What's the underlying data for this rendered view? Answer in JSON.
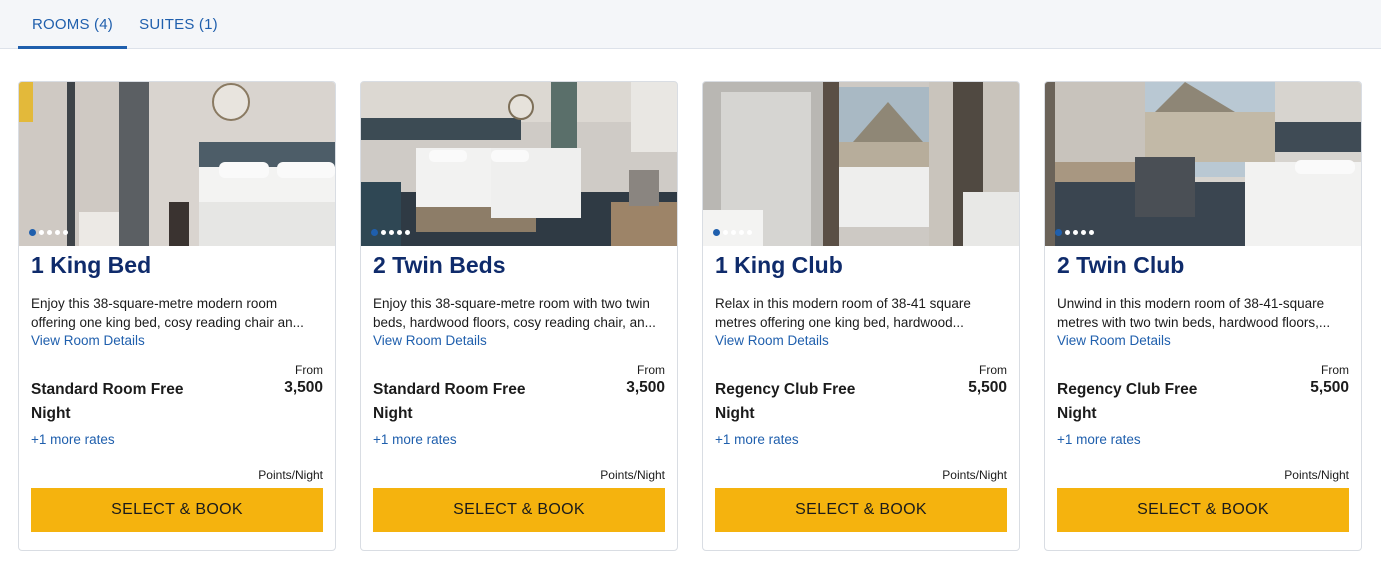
{
  "tabs": [
    {
      "label": "ROOMS (4)",
      "active": true
    },
    {
      "label": "SUITES (1)",
      "active": false
    }
  ],
  "colors": {
    "accent": "#1f5fad",
    "title": "#0f2b6b",
    "button": "#f5b30e"
  },
  "rooms": [
    {
      "title": "1 King Bed",
      "description": "Enjoy this 38-square-metre modern room offering one king bed, cosy reading chair an...",
      "details_link": "View Room Details",
      "from_label": "From",
      "rate_name": "Standard Room Free Night",
      "points": "3,500",
      "more_rates": "+1 more rates",
      "points_unit": "Points/Night",
      "button": "SELECT & BOOK"
    },
    {
      "title": "2 Twin Beds",
      "description": "Enjoy this 38-square-metre room with two twin beds, hardwood floors, cosy reading chair, an...",
      "details_link": "View Room Details",
      "from_label": "From",
      "rate_name": "Standard Room Free Night",
      "points": "3,500",
      "more_rates": "+1 more rates",
      "points_unit": "Points/Night",
      "button": "SELECT & BOOK"
    },
    {
      "title": "1 King Club",
      "description": "Relax in this modern room of 38-41 square metres offering one king bed, hardwood...",
      "details_link": "View Room Details",
      "from_label": "From",
      "rate_name": "Regency Club Free Night",
      "points": "5,500",
      "more_rates": "+1 more rates",
      "points_unit": "Points/Night",
      "button": "SELECT & BOOK"
    },
    {
      "title": "2 Twin Club",
      "description": "Unwind in this modern room of 38-41-square metres with two twin beds, hardwood floors,...",
      "details_link": "View Room Details",
      "from_label": "From",
      "rate_name": "Regency Club Free Night",
      "points": "5,500",
      "more_rates": "+1 more rates",
      "points_unit": "Points/Night",
      "button": "SELECT & BOOK"
    }
  ]
}
